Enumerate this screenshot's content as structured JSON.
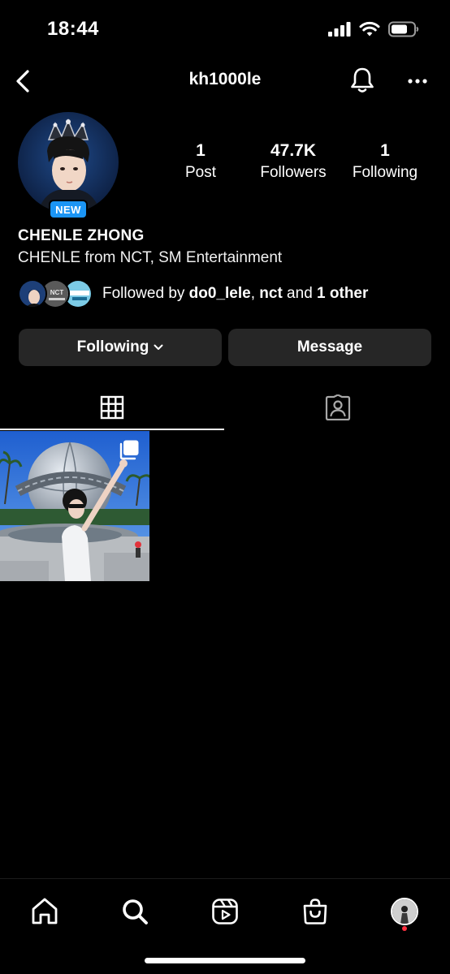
{
  "status_bar": {
    "time": "18:44"
  },
  "header": {
    "username": "kh1000le",
    "back_icon": "chevron-left-icon",
    "bell_icon": "bell-icon",
    "more_icon": "more-horizontal-icon"
  },
  "profile": {
    "new_badge": "NEW",
    "stats": [
      {
        "value": "1",
        "label": "Post"
      },
      {
        "value": "47.7K",
        "label": "Followers"
      },
      {
        "value": "1",
        "label": "Following"
      }
    ],
    "full_name": "CHENLE ZHONG",
    "bio": "CHENLE from NCT, SM Entertainment",
    "followed_by": {
      "prefix": "Followed by ",
      "user1": "do0_lele",
      "separator": ", ",
      "user2": "nct",
      "joiner": " and ",
      "others": "1 other"
    }
  },
  "actions": {
    "following_label": "Following",
    "message_label": "Message"
  },
  "tabs": [
    {
      "name": "grid",
      "icon": "grid-icon",
      "active": true
    },
    {
      "name": "tagged",
      "icon": "tagged-user-icon",
      "active": false
    }
  ],
  "bottom_nav": [
    {
      "name": "home",
      "icon": "home-icon"
    },
    {
      "name": "search",
      "icon": "search-icon"
    },
    {
      "name": "reels",
      "icon": "reels-icon"
    },
    {
      "name": "shop",
      "icon": "shopping-bag-icon"
    },
    {
      "name": "profile",
      "icon": "avatar"
    }
  ],
  "colors": {
    "background": "#000000",
    "button_bg": "#262626",
    "badge_blue": "#1b95f5",
    "notification_red": "#ff3040"
  }
}
